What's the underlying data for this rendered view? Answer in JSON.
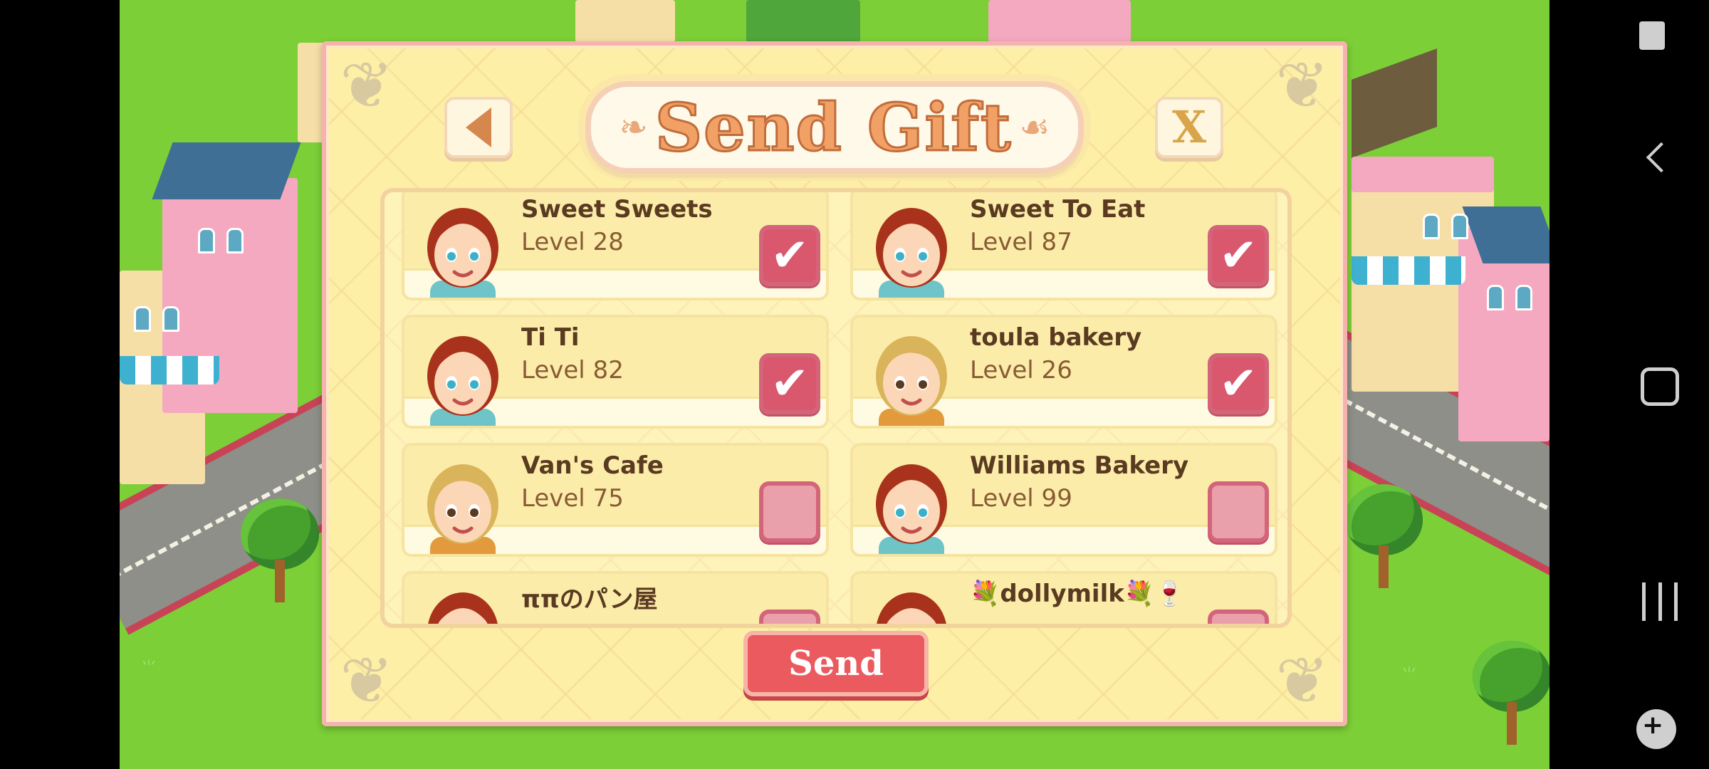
{
  "dialog": {
    "title": "Send Gift",
    "send_label": "Send",
    "close_label": "X"
  },
  "friends": [
    {
      "name": "Sweet Sweets",
      "level": "Level 28",
      "checked": true,
      "avatar": "girl-red-hair"
    },
    {
      "name": "Sweet To Eat",
      "level": "Level 87",
      "checked": true,
      "avatar": "girl-red-hair"
    },
    {
      "name": "Ti Ti",
      "level": "Level 82",
      "checked": true,
      "avatar": "girl-red-hair"
    },
    {
      "name": "toula bakery",
      "level": "Level 26",
      "checked": true,
      "avatar": "boy-blond"
    },
    {
      "name": "Van's Cafe",
      "level": "Level 75",
      "checked": false,
      "avatar": "boy-blond"
    },
    {
      "name": "Williams Bakery",
      "level": "Level 99",
      "checked": false,
      "avatar": "girl-red-hair"
    },
    {
      "name": "ππのパン屋",
      "level": "",
      "checked": false,
      "avatar": "girl-red-hair"
    },
    {
      "name": "💐dollymilk💐🍷",
      "level": "",
      "checked": false,
      "avatar": "girl-red-hair"
    }
  ],
  "colors": {
    "dialog_bg": "#fdf0a6",
    "send_button": "#ea5a5e",
    "checkbox": "#d9586e",
    "title": "#f2a166"
  }
}
